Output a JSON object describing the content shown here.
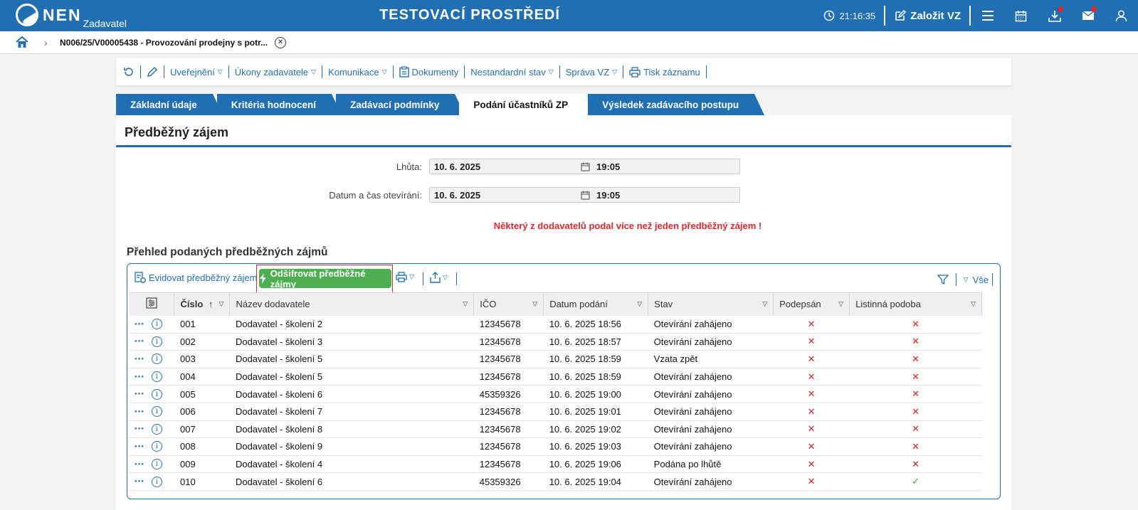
{
  "topbar": {
    "logo_text": "NEN",
    "logo_sub": "Zadavatel",
    "env_title": "TESTOVACÍ PROSTŘEDÍ",
    "clock": "21:16:35",
    "create_label": "Založit VZ"
  },
  "breadcrumb": {
    "text": "N006/25/V00005438 - Provozování prodejny s potr..."
  },
  "toolbar": {
    "items": [
      "Uveřejnění",
      "Úkony zadavatele",
      "Komunikace",
      "Dokumenty",
      "Nestandardní stav",
      "Správa VZ",
      "Tisk záznamu"
    ]
  },
  "tabs": [
    "Základní údaje",
    "Kritéria hodnocení",
    "Zadávací podmínky",
    "Podání účastníků ZP",
    "Výsledek zadávacího postupu"
  ],
  "active_tab": "Podání účastníků ZP",
  "panel": {
    "title": "Předběžný zájem",
    "lhuta_label": "Lhůta:",
    "lhuta_date": "10. 6. 2025",
    "lhuta_time": "19:05",
    "otevirani_label": "Datum a čas otevírání:",
    "otevirani_date": "10. 6. 2025",
    "otevirani_time": "19:05",
    "warning": "Některý z dodavatelů podal více než jeden předběžný zájem !",
    "section_title": "Přehled podaných předběžných zájmů"
  },
  "grid": {
    "evidovat_label": "Evidovat předběžný zájem",
    "odsifrovat_label": "Odšifrovat předběžné zájmy",
    "vse_label": "Vše",
    "columns": [
      "Číslo",
      "Název dodavatele",
      "IČO",
      "Datum podání",
      "Stav",
      "Podepsán",
      "Listinná podoba"
    ],
    "rows": [
      {
        "cislo": "001",
        "nazev": "Dodavatel - školení 2",
        "ico": "12345678",
        "datum": "10. 6. 2025 18:56",
        "stav": "Otevírání zahájeno",
        "podepsan": "✕",
        "listinna": "✕"
      },
      {
        "cislo": "002",
        "nazev": "Dodavatel - školení 3",
        "ico": "12345678",
        "datum": "10. 6. 2025 18:57",
        "stav": "Otevírání zahájeno",
        "podepsan": "✕",
        "listinna": "✕"
      },
      {
        "cislo": "003",
        "nazev": "Dodavatel - školení 5",
        "ico": "12345678",
        "datum": "10. 6. 2025 18:59",
        "stav": "Vzata zpět",
        "podepsan": "✕",
        "listinna": "✕"
      },
      {
        "cislo": "004",
        "nazev": "Dodavatel - školení 5",
        "ico": "12345678",
        "datum": "10. 6. 2025 18:59",
        "stav": "Otevírání zahájeno",
        "podepsan": "✕",
        "listinna": "✕"
      },
      {
        "cislo": "005",
        "nazev": "Dodavatel - školení 6",
        "ico": "45359326",
        "datum": "10. 6. 2025 19:00",
        "stav": "Otevírání zahájeno",
        "podepsan": "✕",
        "listinna": "✕"
      },
      {
        "cislo": "006",
        "nazev": "Dodavatel - školení 7",
        "ico": "12345678",
        "datum": "10. 6. 2025 19:01",
        "stav": "Otevírání zahájeno",
        "podepsan": "✕",
        "listinna": "✕"
      },
      {
        "cislo": "007",
        "nazev": "Dodavatel - školení 8",
        "ico": "12345678",
        "datum": "10. 6. 2025 19:02",
        "stav": "Otevírání zahájeno",
        "podepsan": "✕",
        "listinna": "✕"
      },
      {
        "cislo": "008",
        "nazev": "Dodavatel - školení 9",
        "ico": "12345678",
        "datum": "10. 6. 2025 19:03",
        "stav": "Otevírání zahájeno",
        "podepsan": "✕",
        "listinna": "✕"
      },
      {
        "cislo": "009",
        "nazev": "Dodavatel - školení 4",
        "ico": "12345678",
        "datum": "10. 6. 2025 19:06",
        "stav": "Podána po lhůtě",
        "podepsan": "✕",
        "listinna": "✕"
      },
      {
        "cislo": "010",
        "nazev": "Dodavatel - školení 6",
        "ico": "45359326",
        "datum": "10. 6. 2025 19:04",
        "stav": "Otevírání zahájeno",
        "podepsan": "✕",
        "listinna": "✓"
      }
    ]
  },
  "colors": {
    "brand": "#1f6fb2",
    "warning": "#e0262a",
    "action_green": "#4caf50",
    "cross": "#d22222",
    "check": "#3aa53a"
  }
}
